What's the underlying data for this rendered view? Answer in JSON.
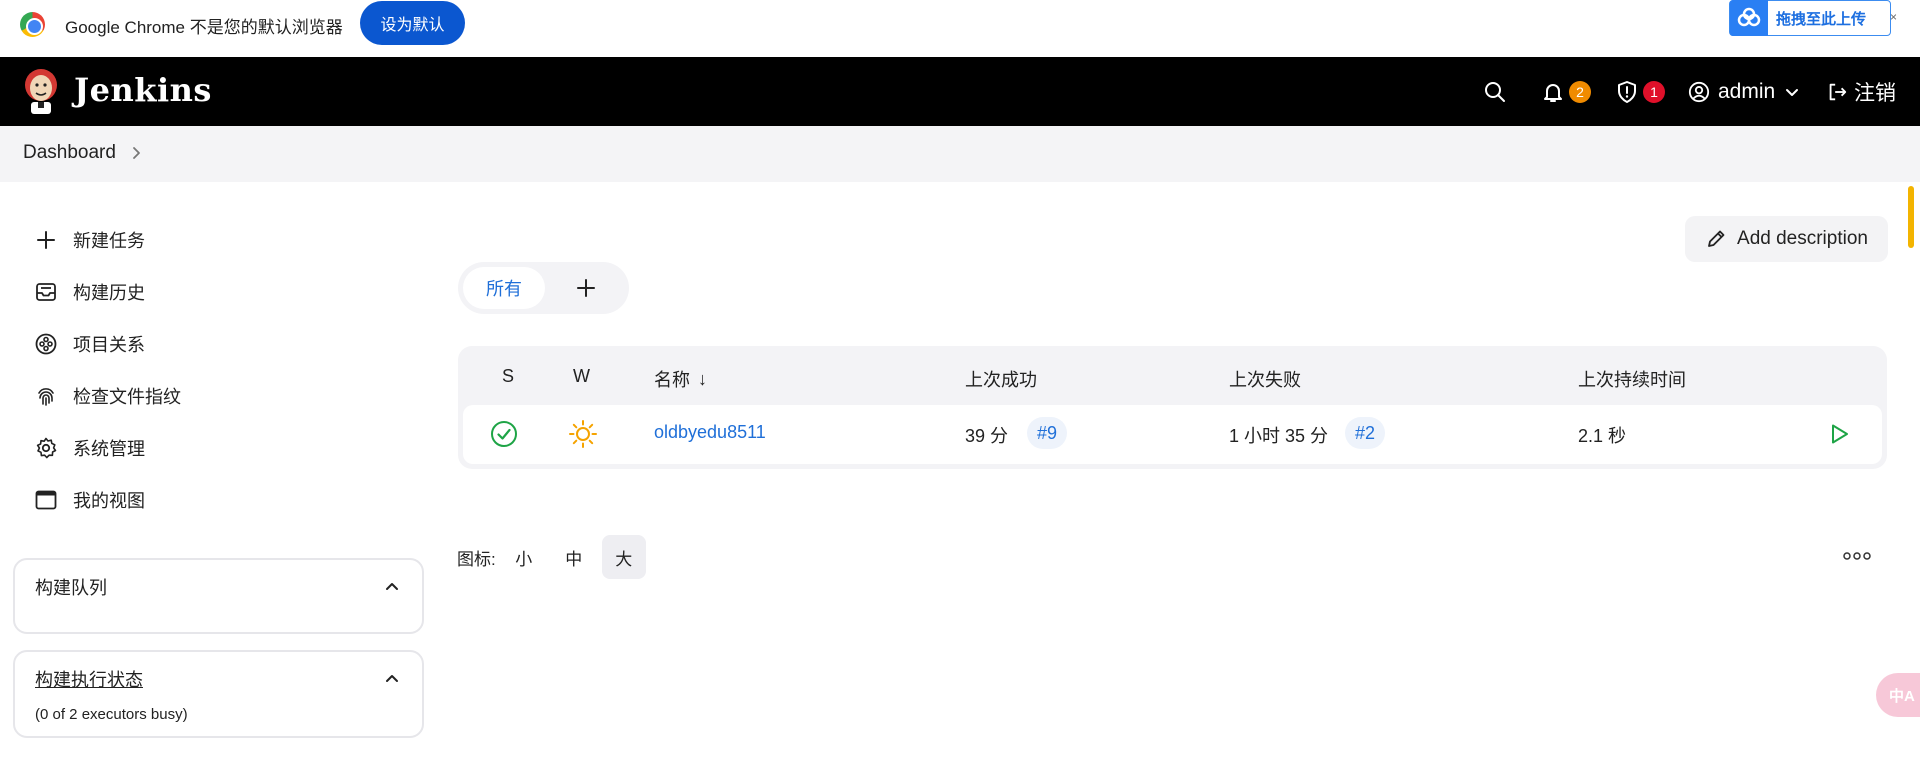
{
  "infobar": {
    "message": "Google Chrome 不是您的默认浏览器",
    "set_default_label": "设为默认",
    "upload_label": "拖拽至此上传"
  },
  "header": {
    "brand": "Jenkins",
    "notifications_count": "2",
    "security_count": "1",
    "user": "admin",
    "logout_label": "注销"
  },
  "breadcrumb": {
    "items": [
      "Dashboard"
    ]
  },
  "sidebar": {
    "items": [
      {
        "label": "新建任务",
        "icon": "plus-icon"
      },
      {
        "label": "构建历史",
        "icon": "inbox-icon"
      },
      {
        "label": "项目关系",
        "icon": "relationship-icon"
      },
      {
        "label": "检查文件指纹",
        "icon": "fingerprint-icon"
      },
      {
        "label": "系统管理",
        "icon": "gear-icon"
      },
      {
        "label": "我的视图",
        "icon": "window-icon"
      }
    ],
    "build_queue": {
      "title": "构建队列"
    },
    "executor_status": {
      "title": "构建执行状态",
      "summary": "(0 of 2 executors busy)"
    }
  },
  "main": {
    "add_description_label": "Add description",
    "tabs": [
      {
        "label": "所有",
        "active": true
      }
    ],
    "table": {
      "headers": {
        "s": "S",
        "w": "W",
        "name": "名称",
        "last_success": "上次成功",
        "last_failure": "上次失败",
        "last_duration": "上次持续时间"
      },
      "sort_indicator": "↓",
      "rows": [
        {
          "status": "success",
          "weather": "sunny",
          "name": "oldbyedu8511",
          "last_success": "39 分",
          "last_success_build": "#9",
          "last_failure": "1 小时 35 分",
          "last_failure_build": "#2",
          "last_duration": "2.1 秒"
        }
      ]
    },
    "icon_size": {
      "label": "图标:",
      "options": [
        "小",
        "中",
        "大"
      ],
      "selected": "大"
    }
  },
  "colors": {
    "accent": "#1f6fd8",
    "header_bg": "#000000",
    "success": "#1ea446",
    "weather": "#f5a300",
    "badge_orange": "#f08b00",
    "badge_red": "#e0102a"
  },
  "translate_fab": "中A"
}
